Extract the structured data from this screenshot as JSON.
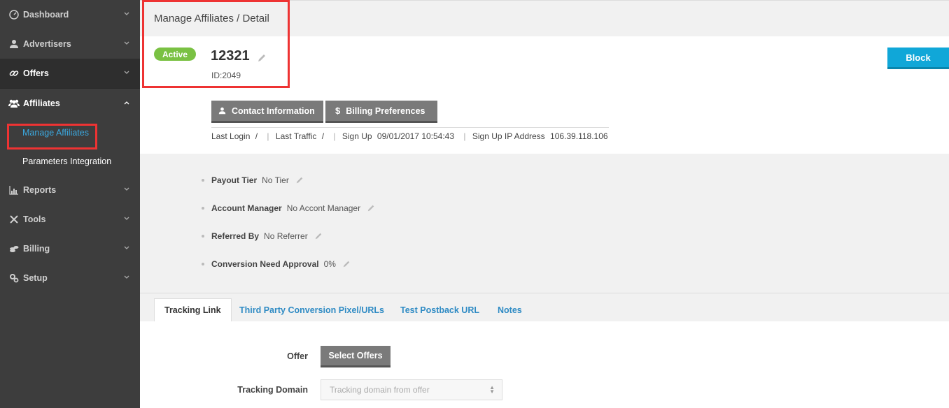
{
  "sidebar": {
    "items": [
      {
        "label": "Dashboard",
        "icon": "dashboard-icon"
      },
      {
        "label": "Advertisers",
        "icon": "user-icon"
      },
      {
        "label": "Offers",
        "icon": "link-icon"
      },
      {
        "label": "Affiliates",
        "icon": "users-icon"
      },
      {
        "label": "Reports",
        "icon": "bar-chart-icon"
      },
      {
        "label": "Tools",
        "icon": "tools-icon"
      },
      {
        "label": "Billing",
        "icon": "coins-icon"
      },
      {
        "label": "Setup",
        "icon": "gears-icon"
      }
    ],
    "sub_items": [
      {
        "label": "Manage Affiliates"
      },
      {
        "label": "Parameters Integration"
      }
    ]
  },
  "breadcrumb": "Manage Affiliates / Detail",
  "affiliate": {
    "status": "Active",
    "name": "12321",
    "id_text": "ID:2049"
  },
  "actions": {
    "block_label": "Block",
    "contact_label": "Contact Information",
    "billing_label": "Billing Preferences"
  },
  "meta": {
    "last_login_label": "Last Login",
    "last_login_value": "/",
    "last_traffic_label": "Last Traffic",
    "last_traffic_value": "/",
    "sign_up_label": "Sign Up",
    "sign_up_value": "09/01/2017 10:54:43",
    "ip_label": "Sign Up IP Address",
    "ip_value": "106.39.118.106"
  },
  "details": [
    {
      "label": "Payout Tier",
      "value": "No Tier"
    },
    {
      "label": "Account Manager",
      "value": "No Accont Manager"
    },
    {
      "label": "Referred By",
      "value": "No Referrer"
    },
    {
      "label": "Conversion Need Approval",
      "value": "0%"
    }
  ],
  "tabs": [
    {
      "label": "Tracking Link"
    },
    {
      "label": "Third Party Conversion Pixel/URLs"
    },
    {
      "label": "Test Postback URL"
    },
    {
      "label": "Notes"
    }
  ],
  "form": {
    "offer_label": "Offer",
    "select_offers_label": "Select Offers",
    "domain_label": "Tracking Domain",
    "domain_placeholder": "Tracking domain from offer"
  },
  "colors": {
    "sidebar_bg": "#3d3d3d",
    "accent_blue": "#10a7d8",
    "active_green": "#7ac143",
    "highlight_red": "#ee3333",
    "link_blue": "#2f8bc4"
  }
}
